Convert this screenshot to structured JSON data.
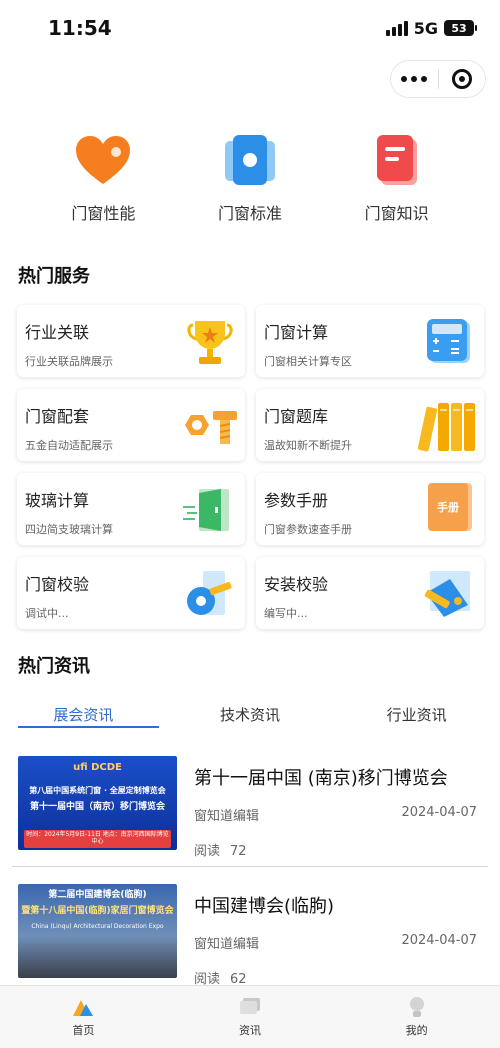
{
  "status_bar": {
    "time": "11:54",
    "network": "5G",
    "battery": "53"
  },
  "top_nav": [
    {
      "label": "门窗性能",
      "icon": "heart-icon"
    },
    {
      "label": "门窗标准",
      "icon": "cards-icon"
    },
    {
      "label": "门窗知识",
      "icon": "book-icon"
    }
  ],
  "hot_services": {
    "title": "热门服务",
    "items": [
      {
        "title": "行业关联",
        "subtitle": "行业关联品牌展示",
        "icon": "trophy-icon"
      },
      {
        "title": "门窗计算",
        "subtitle": "门窗相关计算专区",
        "icon": "calculator-icon"
      },
      {
        "title": "门窗配套",
        "subtitle": "五金自动适配展示",
        "icon": "bolt-nut-icon"
      },
      {
        "title": "门窗题库",
        "subtitle": "温故知新不断提升",
        "icon": "books-icon"
      },
      {
        "title": "玻璃计算",
        "subtitle": "四边简支玻璃计算",
        "icon": "door-icon"
      },
      {
        "title": "参数手册",
        "subtitle": "门窗参数速查手册",
        "icon": "handbook-icon"
      },
      {
        "title": "门窗校验",
        "subtitle": "调试中...",
        "icon": "tape-measure-icon"
      },
      {
        "title": "安装校验",
        "subtitle": "编写中...",
        "icon": "measure-window-icon"
      }
    ],
    "handbook_icon_text": "手册"
  },
  "hot_news": {
    "title": "热门资讯",
    "tabs": [
      "展会资讯",
      "技术资讯",
      "行业资讯"
    ],
    "active_tab": 0,
    "items": [
      {
        "title": "第十一届中国 (南京)移门博览会",
        "author": "窗知道编辑",
        "date": "2024-04-07",
        "reads_label": "阅读",
        "reads": "72",
        "thumb": {
          "logo": "ufi DCDE",
          "line1": "第八届中国系统门窗 · 全屋定制博览会",
          "line2": "第十一届中国（南京）移门博览会",
          "line3": "时间：2024年5月9日-11日  地点：南京河西国际博览中心"
        }
      },
      {
        "title": "中国建博会(临朐)",
        "author": "窗知道编辑",
        "date": "2024-04-07",
        "reads_label": "阅读",
        "reads": "62",
        "thumb": {
          "line1": "第二届中国建博会(临朐)",
          "line2": "暨第十八届中国(临朐)家居门窗博览会",
          "line3": "China (Linqu) Architectural Decoration Expo"
        }
      }
    ]
  },
  "tab_bar": [
    {
      "label": "首页",
      "icon": "home-icon"
    },
    {
      "label": "资讯",
      "icon": "news-icon"
    },
    {
      "label": "我的",
      "icon": "profile-icon"
    }
  ]
}
